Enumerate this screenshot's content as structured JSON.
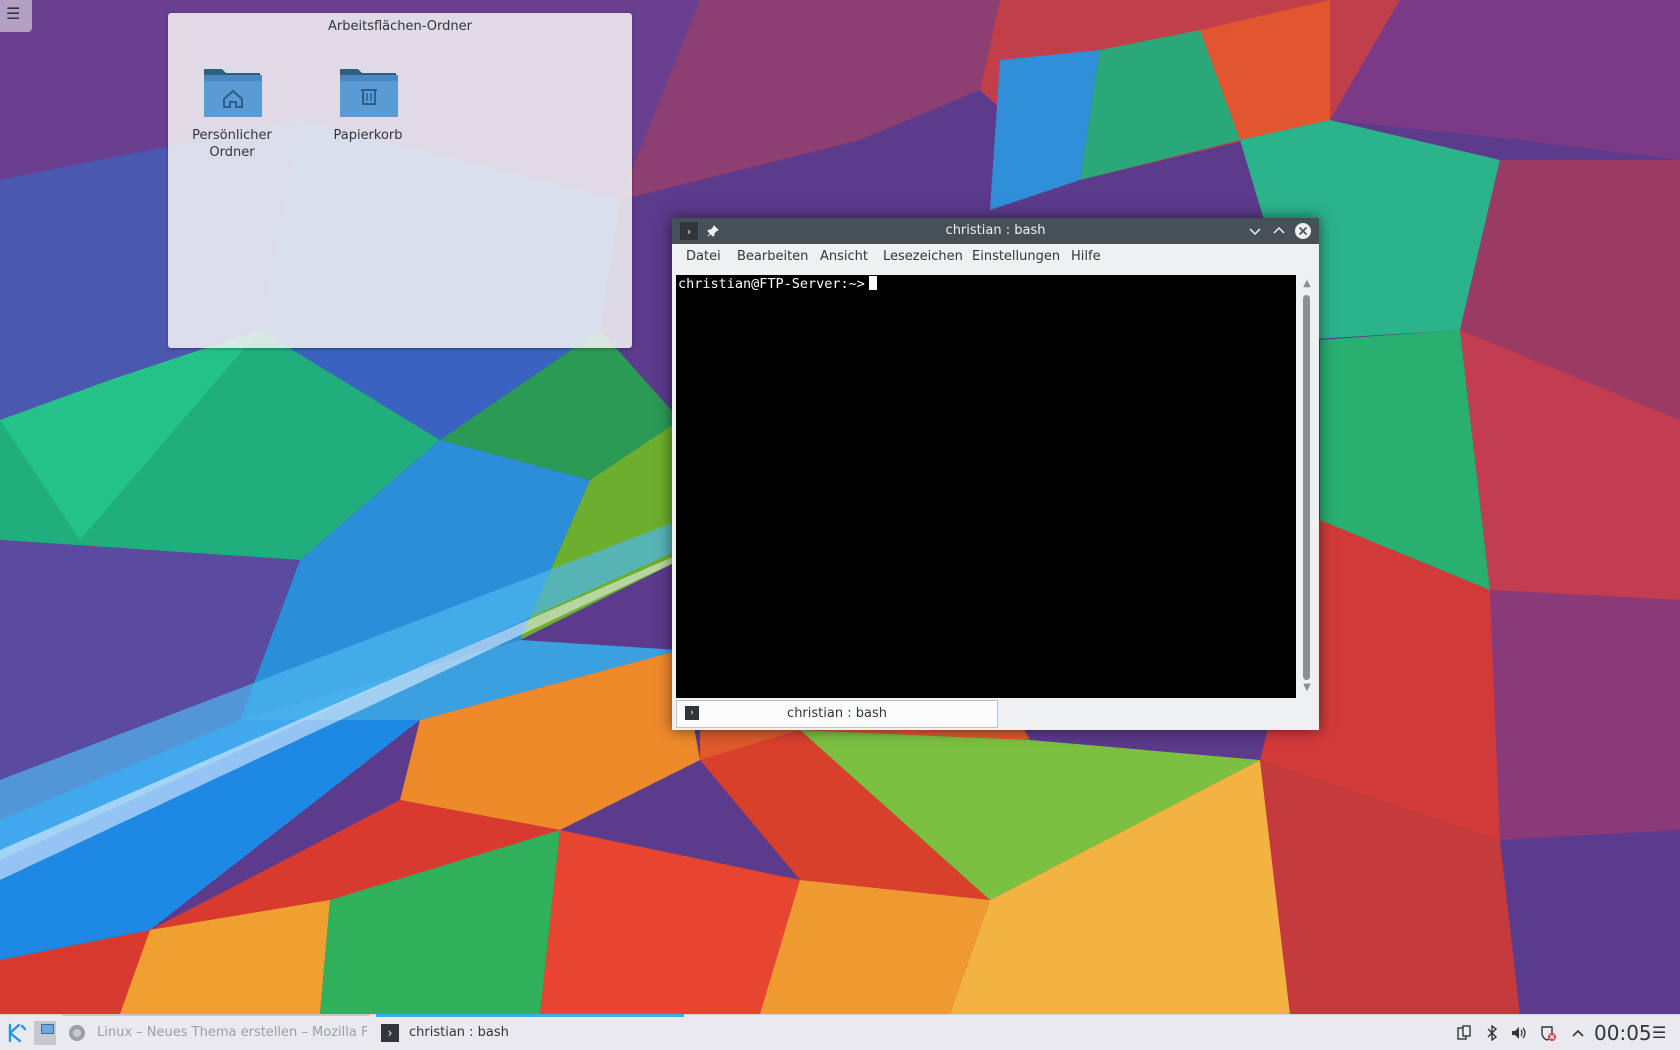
{
  "desktop": {
    "folderview": {
      "title": "Arbeitsflächen-Ordner",
      "items": [
        {
          "label_line1": "Persönlicher",
          "label_line2": "Ordner",
          "icon": "home-folder-icon"
        },
        {
          "label_line1": "Papierkorb",
          "label_line2": "",
          "icon": "trash-folder-icon"
        }
      ]
    }
  },
  "window": {
    "title": "christian : bash",
    "menu": [
      "Datei",
      "Bearbeiten",
      "Ansicht",
      "Lesezeichen",
      "Einstellungen",
      "Hilfe"
    ],
    "terminal": {
      "prompt": "christian@FTP-Server:~>"
    },
    "tab_label": "christian : bash"
  },
  "panel": {
    "tasks": [
      {
        "label": "Linux – Neues Thema erstellen – Mozilla Firefox",
        "active": false
      },
      {
        "label": "christian : bash",
        "active": true
      }
    ],
    "clock": "00:05"
  },
  "colors": {
    "titlebar": "#475057",
    "accent": "#3daee9",
    "panel": "#eff0f1"
  }
}
